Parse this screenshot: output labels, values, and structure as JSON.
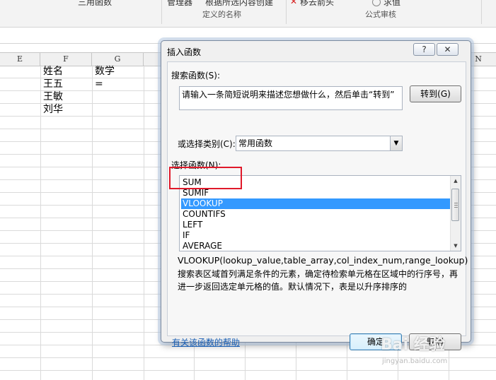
{
  "ribbon": {
    "top_fragment_1": "三用函数",
    "top_fragment_2": "管理器",
    "top_fragment_3": "根据所选内容创建",
    "top_fragment_4": "移去箭头",
    "top_fragment_5": "求值",
    "group_defined_names": "定义的名称",
    "group_formula_audit": "公式审核"
  },
  "sheet": {
    "columns": [
      "E",
      "F",
      "G",
      "N"
    ],
    "cells": {
      "f1": "姓名",
      "g1": "数学",
      "f2": "王五",
      "g2": "=",
      "f3": "王敏",
      "f4": "刘华"
    }
  },
  "dialog": {
    "title": "插入函数",
    "help_btn": "?",
    "close_btn": "✕",
    "search_label": "搜索函数(S):",
    "search_value": "请输入一条简短说明来描述您想做什么，然后单击“转到”",
    "go_button": "转到(G)",
    "category_label": "或选择类别(C):",
    "category_value": "常用函数",
    "select_label": "选择函数(N):",
    "functions": [
      "SUM",
      "SUMIF",
      "VLOOKUP",
      "COUNTIFS",
      "LEFT",
      "IF",
      "AVERAGE"
    ],
    "selected_function": "VLOOKUP",
    "signature": "VLOOKUP(lookup_value,table_array,col_index_num,range_lookup)",
    "description": "搜索表区域首列满足条件的元素，确定待检索单元格在区域中的行序号，再进一步返回选定单元格的值。默认情况下，表是以升序排序的",
    "help_link": "有关该函数的帮助",
    "ok_button": "确定",
    "cancel_button": "取消"
  },
  "watermark": {
    "brand": "Bai 经验",
    "url": "jingyan.baidu.com"
  },
  "colors": {
    "selection": "#3399ff",
    "highlight_box": "#e0192a",
    "link": "#1a5fb4"
  }
}
